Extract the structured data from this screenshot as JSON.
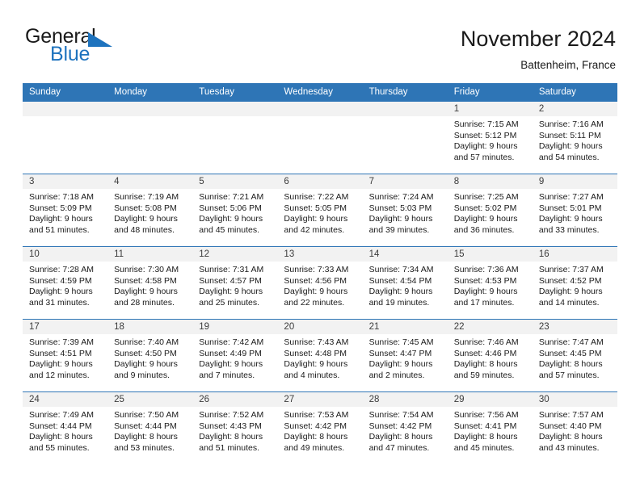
{
  "brand": {
    "name_part1": "General",
    "name_part2": "Blue",
    "triangle_icon": "triangle-icon",
    "accent_color": "#1e73be"
  },
  "header": {
    "title": "November 2024",
    "subtitle": "Battenheim, France",
    "header_bg_color": "#2e75b6",
    "daynum_bg_color": "#f2f2f2"
  },
  "weekdays": [
    "Sunday",
    "Monday",
    "Tuesday",
    "Wednesday",
    "Thursday",
    "Friday",
    "Saturday"
  ],
  "weeks": [
    [
      {
        "day": "",
        "sunrise": "",
        "sunset": "",
        "daylight": "",
        "empty": true
      },
      {
        "day": "",
        "sunrise": "",
        "sunset": "",
        "daylight": "",
        "empty": true
      },
      {
        "day": "",
        "sunrise": "",
        "sunset": "",
        "daylight": "",
        "empty": true
      },
      {
        "day": "",
        "sunrise": "",
        "sunset": "",
        "daylight": "",
        "empty": true
      },
      {
        "day": "",
        "sunrise": "",
        "sunset": "",
        "daylight": "",
        "empty": true
      },
      {
        "day": "1",
        "sunrise": "Sunrise: 7:15 AM",
        "sunset": "Sunset: 5:12 PM",
        "daylight": "Daylight: 9 hours and 57 minutes."
      },
      {
        "day": "2",
        "sunrise": "Sunrise: 7:16 AM",
        "sunset": "Sunset: 5:11 PM",
        "daylight": "Daylight: 9 hours and 54 minutes."
      }
    ],
    [
      {
        "day": "3",
        "sunrise": "Sunrise: 7:18 AM",
        "sunset": "Sunset: 5:09 PM",
        "daylight": "Daylight: 9 hours and 51 minutes."
      },
      {
        "day": "4",
        "sunrise": "Sunrise: 7:19 AM",
        "sunset": "Sunset: 5:08 PM",
        "daylight": "Daylight: 9 hours and 48 minutes."
      },
      {
        "day": "5",
        "sunrise": "Sunrise: 7:21 AM",
        "sunset": "Sunset: 5:06 PM",
        "daylight": "Daylight: 9 hours and 45 minutes."
      },
      {
        "day": "6",
        "sunrise": "Sunrise: 7:22 AM",
        "sunset": "Sunset: 5:05 PM",
        "daylight": "Daylight: 9 hours and 42 minutes."
      },
      {
        "day": "7",
        "sunrise": "Sunrise: 7:24 AM",
        "sunset": "Sunset: 5:03 PM",
        "daylight": "Daylight: 9 hours and 39 minutes."
      },
      {
        "day": "8",
        "sunrise": "Sunrise: 7:25 AM",
        "sunset": "Sunset: 5:02 PM",
        "daylight": "Daylight: 9 hours and 36 minutes."
      },
      {
        "day": "9",
        "sunrise": "Sunrise: 7:27 AM",
        "sunset": "Sunset: 5:01 PM",
        "daylight": "Daylight: 9 hours and 33 minutes."
      }
    ],
    [
      {
        "day": "10",
        "sunrise": "Sunrise: 7:28 AM",
        "sunset": "Sunset: 4:59 PM",
        "daylight": "Daylight: 9 hours and 31 minutes."
      },
      {
        "day": "11",
        "sunrise": "Sunrise: 7:30 AM",
        "sunset": "Sunset: 4:58 PM",
        "daylight": "Daylight: 9 hours and 28 minutes."
      },
      {
        "day": "12",
        "sunrise": "Sunrise: 7:31 AM",
        "sunset": "Sunset: 4:57 PM",
        "daylight": "Daylight: 9 hours and 25 minutes."
      },
      {
        "day": "13",
        "sunrise": "Sunrise: 7:33 AM",
        "sunset": "Sunset: 4:56 PM",
        "daylight": "Daylight: 9 hours and 22 minutes."
      },
      {
        "day": "14",
        "sunrise": "Sunrise: 7:34 AM",
        "sunset": "Sunset: 4:54 PM",
        "daylight": "Daylight: 9 hours and 19 minutes."
      },
      {
        "day": "15",
        "sunrise": "Sunrise: 7:36 AM",
        "sunset": "Sunset: 4:53 PM",
        "daylight": "Daylight: 9 hours and 17 minutes."
      },
      {
        "day": "16",
        "sunrise": "Sunrise: 7:37 AM",
        "sunset": "Sunset: 4:52 PM",
        "daylight": "Daylight: 9 hours and 14 minutes."
      }
    ],
    [
      {
        "day": "17",
        "sunrise": "Sunrise: 7:39 AM",
        "sunset": "Sunset: 4:51 PM",
        "daylight": "Daylight: 9 hours and 12 minutes."
      },
      {
        "day": "18",
        "sunrise": "Sunrise: 7:40 AM",
        "sunset": "Sunset: 4:50 PM",
        "daylight": "Daylight: 9 hours and 9 minutes."
      },
      {
        "day": "19",
        "sunrise": "Sunrise: 7:42 AM",
        "sunset": "Sunset: 4:49 PM",
        "daylight": "Daylight: 9 hours and 7 minutes."
      },
      {
        "day": "20",
        "sunrise": "Sunrise: 7:43 AM",
        "sunset": "Sunset: 4:48 PM",
        "daylight": "Daylight: 9 hours and 4 minutes."
      },
      {
        "day": "21",
        "sunrise": "Sunrise: 7:45 AM",
        "sunset": "Sunset: 4:47 PM",
        "daylight": "Daylight: 9 hours and 2 minutes."
      },
      {
        "day": "22",
        "sunrise": "Sunrise: 7:46 AM",
        "sunset": "Sunset: 4:46 PM",
        "daylight": "Daylight: 8 hours and 59 minutes."
      },
      {
        "day": "23",
        "sunrise": "Sunrise: 7:47 AM",
        "sunset": "Sunset: 4:45 PM",
        "daylight": "Daylight: 8 hours and 57 minutes."
      }
    ],
    [
      {
        "day": "24",
        "sunrise": "Sunrise: 7:49 AM",
        "sunset": "Sunset: 4:44 PM",
        "daylight": "Daylight: 8 hours and 55 minutes."
      },
      {
        "day": "25",
        "sunrise": "Sunrise: 7:50 AM",
        "sunset": "Sunset: 4:44 PM",
        "daylight": "Daylight: 8 hours and 53 minutes."
      },
      {
        "day": "26",
        "sunrise": "Sunrise: 7:52 AM",
        "sunset": "Sunset: 4:43 PM",
        "daylight": "Daylight: 8 hours and 51 minutes."
      },
      {
        "day": "27",
        "sunrise": "Sunrise: 7:53 AM",
        "sunset": "Sunset: 4:42 PM",
        "daylight": "Daylight: 8 hours and 49 minutes."
      },
      {
        "day": "28",
        "sunrise": "Sunrise: 7:54 AM",
        "sunset": "Sunset: 4:42 PM",
        "daylight": "Daylight: 8 hours and 47 minutes."
      },
      {
        "day": "29",
        "sunrise": "Sunrise: 7:56 AM",
        "sunset": "Sunset: 4:41 PM",
        "daylight": "Daylight: 8 hours and 45 minutes."
      },
      {
        "day": "30",
        "sunrise": "Sunrise: 7:57 AM",
        "sunset": "Sunset: 4:40 PM",
        "daylight": "Daylight: 8 hours and 43 minutes."
      }
    ]
  ]
}
